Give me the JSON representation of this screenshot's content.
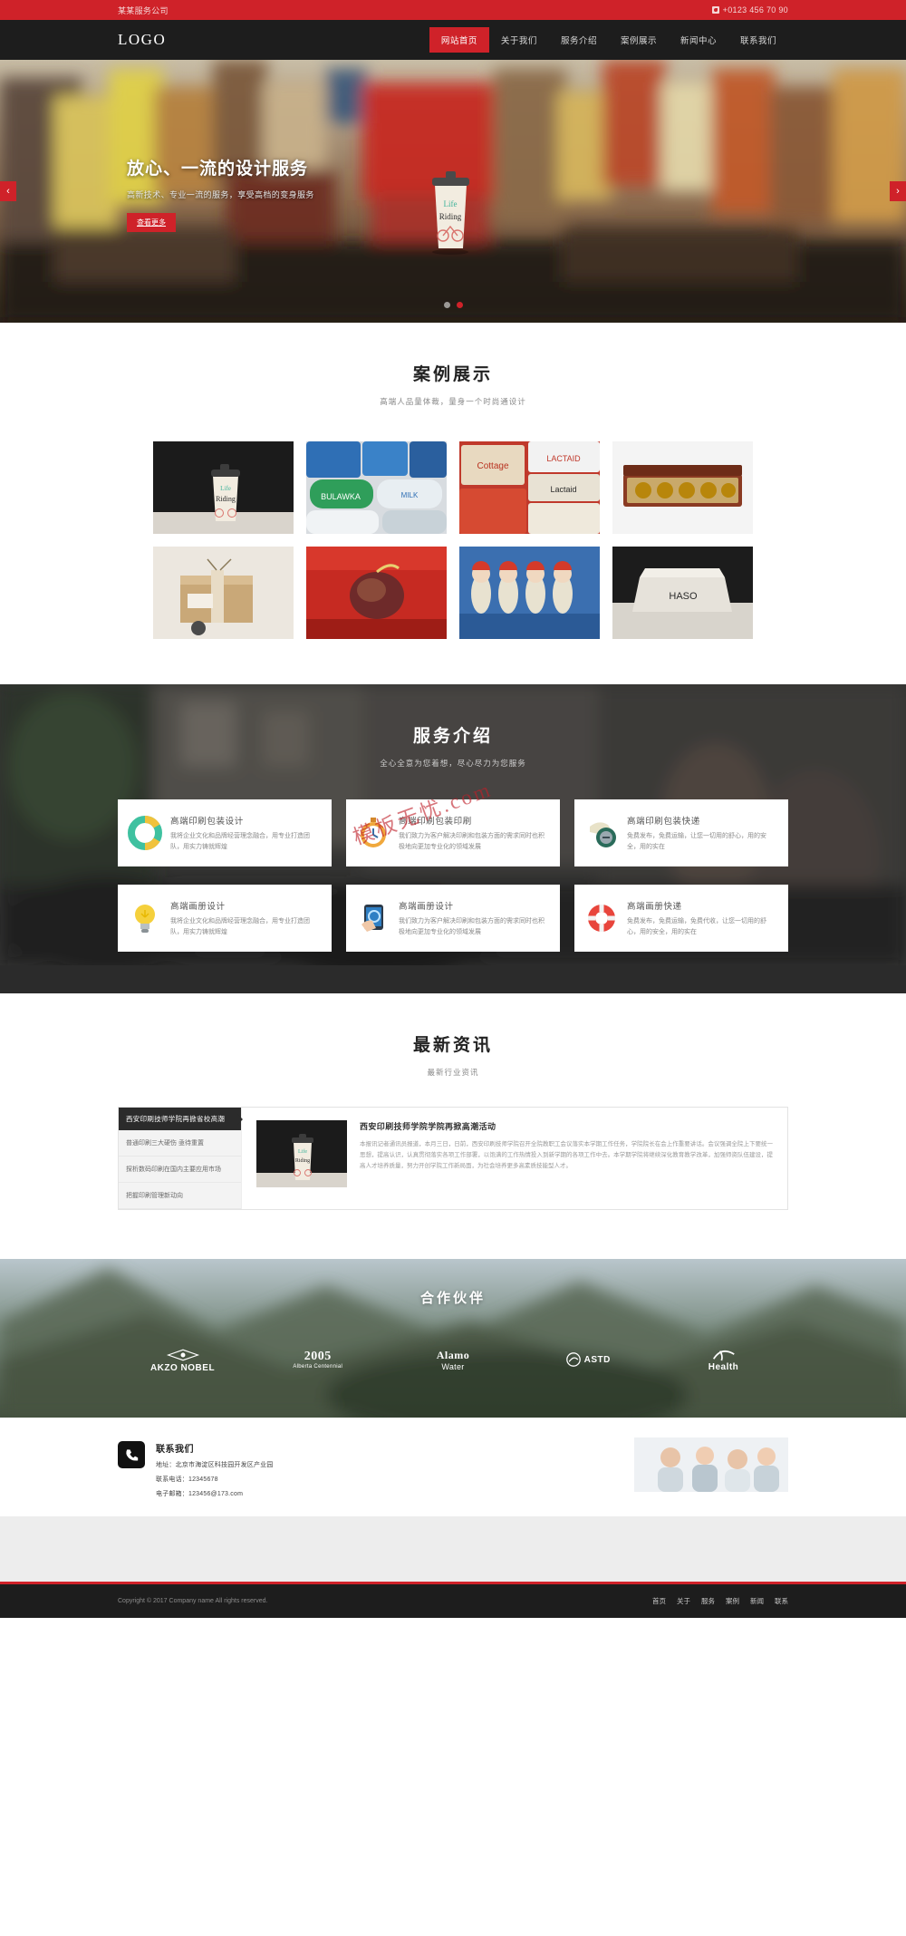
{
  "topbar": {
    "company": "某某服务公司",
    "phone": "+0123 456 70 90",
    "phone_icon": "phone-icon"
  },
  "header": {
    "logo": "LOGO",
    "nav": [
      {
        "label": "网站首页",
        "active": true
      },
      {
        "label": "关于我们",
        "active": false
      },
      {
        "label": "服务介绍",
        "active": false
      },
      {
        "label": "案例展示",
        "active": false
      },
      {
        "label": "新闻中心",
        "active": false
      },
      {
        "label": "联系我们",
        "active": false
      }
    ]
  },
  "hero": {
    "title": "放心、一流的设计服务",
    "subtitle": "高新技术、专业一流的服务，享受高档的变身服务",
    "button": "查看更多",
    "prev_icon": "chevron-left-icon",
    "next_icon": "chevron-right-icon",
    "slides": 2,
    "active_slide": 2
  },
  "cases": {
    "title": "案例展示",
    "subtitle": "高端人品量体裁，量身一个时尚通设计",
    "items": [
      {
        "alt": "咖啡杯包装设计"
      },
      {
        "alt": "牛奶饮品包装"
      },
      {
        "alt": "食品包装盒"
      },
      {
        "alt": "巧克力礼盒包装"
      },
      {
        "alt": "牛皮纸礼盒包装"
      },
      {
        "alt": "红色礼品包装"
      },
      {
        "alt": "圣诞巧克力包装"
      },
      {
        "alt": "手机盒包装设计"
      }
    ]
  },
  "services": {
    "title": "服务介绍",
    "subtitle": "全心全意为您着想，尽心尽力为您服务",
    "watermark": "模板无忧.com",
    "cards": [
      {
        "icon": "donut-chart-icon",
        "title": "高端印刷包装设计",
        "desc": "我将企业文化和品牌经营理念融合，用专业打造团队，用实力铸就辉煌"
      },
      {
        "icon": "stopwatch-icon",
        "title": "高端印刷包装印刷",
        "desc": "我们致力为客户解决印刷和包装方面的需求同时也积极地向更加专业化的领域发展"
      },
      {
        "icon": "seal-icon",
        "title": "高端印刷包装快递",
        "desc": "免费发布，免费运输，让您一切用的舒心，用的安全，用的实在"
      },
      {
        "icon": "lightbulb-icon",
        "title": "高端画册设计",
        "desc": "我将企业文化和品牌经营理念融合，用专业打造团队，用实力铸就辉煌"
      },
      {
        "icon": "mobile-touch-icon",
        "title": "高端画册设计",
        "desc": "我们致力为客户解决印刷和包装方面的需求同时也积极地向更加专业化的领域发展"
      },
      {
        "icon": "lifebuoy-icon",
        "title": "高端画册快递",
        "desc": "免费发布，免费运输，免费代收，让您一切用的舒心，用的安全，用的实在"
      }
    ]
  },
  "news": {
    "title": "最新资讯",
    "subtitle": "最新行业资讯",
    "tab": "西安印刷技师学院再掀省校高潮",
    "list": [
      "普通印刷三大硬伤 亟待重置",
      "探析数码印刷在国内主要应用市场",
      "把握印刷管理新动向"
    ],
    "article": {
      "title": "西安印刷技师学院学院再掀高潮活动",
      "body": "本报讯记者通讯员报道，本月三日，日前，西安印刷技师学院召开全院教职工会议落实本学期工作任务，学院院长在会上作重要讲话。会议强调全院上下要统一思想，提高认识，认真贯彻落实各项工作部署，以饱满的工作热情投入到新学期的各项工作中去。本学期学院将继续深化教育教学改革，加强师资队伍建设，提高人才培养质量，努力开创学院工作新局面，为社会培养更多高素质技能型人才。"
    },
    "thumb_alt": "咖啡杯包装设计"
  },
  "partners": {
    "title": "合作伙伴",
    "logos": [
      {
        "name": "AKZO NOBEL",
        "sub": ""
      },
      {
        "name": "2005",
        "sub": "Alberta Centennial"
      },
      {
        "name": "Alamo",
        "sub": "Water"
      },
      {
        "name": "ASTD",
        "sub": ""
      },
      {
        "name": "Health",
        "sub": ""
      }
    ]
  },
  "contact": {
    "icon": "phone-icon",
    "title": "联系我们",
    "lines": [
      "地址：北京市海淀区科技园开发区产业园",
      "联系电话：12345678",
      "电子邮箱：123456@173.com"
    ],
    "photo_alt": "客服团队照片"
  },
  "footer": {
    "copyright": "Copyright © 2017 Company name All rights reserved.",
    "links": [
      "首页",
      "关于",
      "服务",
      "案例",
      "新闻",
      "联系"
    ]
  },
  "colors": {
    "accent": "#cf2229",
    "dark": "#1d1d1d",
    "panel": "#2b2b2b"
  }
}
